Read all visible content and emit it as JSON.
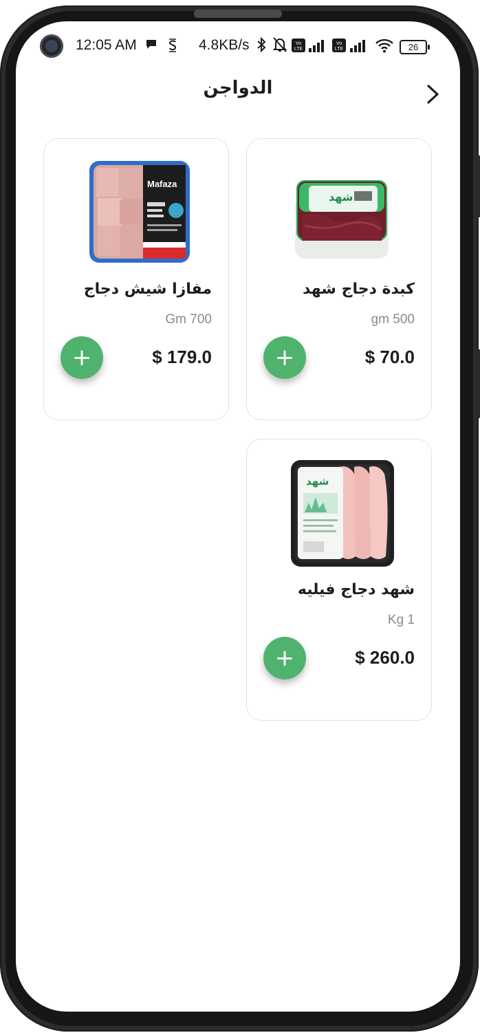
{
  "status_bar": {
    "time": "12:05 AM",
    "network_speed": "4.8KB/s",
    "battery_level": "26",
    "icons": [
      "chat-bubble-icon",
      "sync-s-icon",
      "bluetooth-icon",
      "bell-muted-icon",
      "volte-icon",
      "signal-bars-icon",
      "volte-icon",
      "signal-bars-icon",
      "wifi-icon",
      "battery-icon"
    ]
  },
  "header": {
    "title": "الدواجن",
    "back_icon": "chevron-right-icon"
  },
  "colors": {
    "accent_green": "#4fb36d",
    "price_text": "#1d1d1d",
    "weight_text": "#8a8a8a",
    "card_border": "#e2e2e2"
  },
  "products": [
    {
      "name": "كبدة دجاج شهد",
      "weight": "gm 500",
      "price": "$ 70.0",
      "add_label": "+",
      "image": "chicken-liver-package-image"
    },
    {
      "name": "مفازا شيش دجاج",
      "weight": "Gm 700",
      "price": "$ 179.0",
      "add_label": "+",
      "image": "chicken-shish-tray-image"
    },
    {
      "name": "شهد دجاج فيليه",
      "weight": "Kg 1",
      "price": "$ 260.0",
      "add_label": "+",
      "image": "chicken-fillet-tray-image"
    }
  ]
}
